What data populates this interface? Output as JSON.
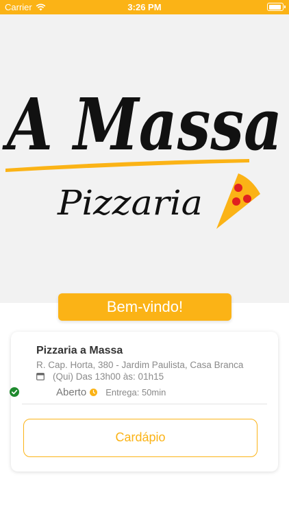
{
  "status_bar": {
    "carrier": "Carrier",
    "time": "3:26 PM"
  },
  "hero": {
    "logo_title": "A Massa",
    "logo_subtitle": "Pizzaria",
    "background_color": "#f2f2f2"
  },
  "welcome": {
    "label": "Bem-vindo!"
  },
  "store": {
    "name": "Pizzaria a Massa",
    "address": "R. Cap. Horta, 380 - Jardim Paulista, Casa Branca",
    "hours": "(Qui) Das 13h00 às: 01h15",
    "status": "Aberto",
    "delivery": "Entrega: 50min"
  },
  "actions": {
    "menu_label": "Cardápio"
  },
  "colors": {
    "accent": "#fbb316",
    "open_green": "#1f8a2e",
    "text_dark": "#333333",
    "text_muted": "#8a8a8a"
  },
  "icons": [
    "wifi-icon",
    "battery-icon",
    "calendar-icon",
    "check-circle-icon",
    "clock-icon",
    "pizza-slice-icon"
  ]
}
